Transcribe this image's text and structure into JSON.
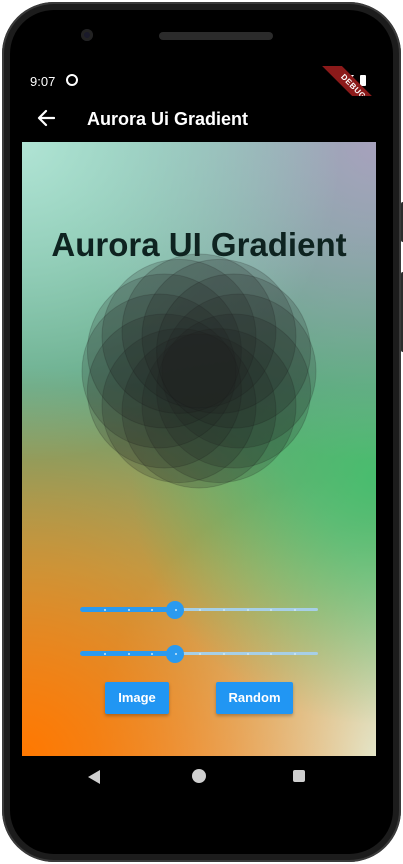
{
  "status_bar": {
    "time": "9:07",
    "debug_banner": "DEBUG"
  },
  "app_bar": {
    "title": "Aurora Ui Gradient",
    "back_icon": "arrow-back-icon"
  },
  "main": {
    "heading": "Aurora UI Gradient",
    "pattern_icon": "flower-of-life-pattern",
    "slider_1": {
      "value": 0.4,
      "divisions": 10,
      "color": "#2a9af0"
    },
    "slider_2": {
      "value": 0.4,
      "divisions": 10,
      "color": "#2a9af0"
    },
    "image_button_label": "Image",
    "random_button_label": "Random"
  },
  "nav_bar": {
    "back_icon": "nav-back-icon",
    "home_icon": "nav-home-icon",
    "recents_icon": "nav-recents-icon"
  },
  "colors": {
    "accent": "#2196f3",
    "gradient_top_left": "#b4e6d7",
    "gradient_top_right": "#aaa0be",
    "gradient_right": "#46be6e",
    "gradient_bottom_left": "#ff7800",
    "gradient_bottom_right": "#e1f0dc"
  }
}
